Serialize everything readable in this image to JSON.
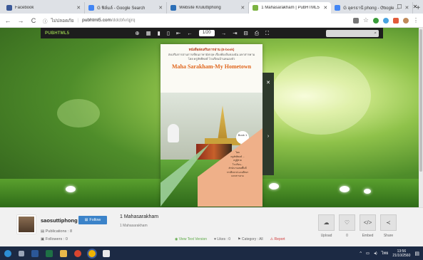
{
  "browser": {
    "tabs": [
      {
        "title": "Facebook",
        "color": "#3b5998",
        "active": false
      },
      {
        "title": "G  ฟิล์มล์ - Google Search",
        "color": "#4285f4",
        "active": false
      },
      {
        "title": "Website Kruluttiphong",
        "color": "#2c6fb7",
        "active": false
      },
      {
        "title": "1 Mahasarakham | PubHTML5",
        "color": "#7cb342",
        "active": true
      },
      {
        "title": "G  อุดรธานี phong - Google Search",
        "color": "#4285f4",
        "active": false
      }
    ],
    "new_tab": "+",
    "window_controls": {
      "minimize": "–",
      "maximize": "☐",
      "close": "✕"
    },
    "nav": {
      "back": "←",
      "forward": "→",
      "reload": "C"
    },
    "security_label": "ไม่ปลอดภัย",
    "url_host": "pubhtml5.com",
    "url_path": "/ddcbfv/qjrq"
  },
  "viewer": {
    "logo": "PUBHTML5",
    "page_field": "1/20",
    "tools": [
      "⊕",
      "▦",
      "▮",
      "▯",
      "⇤",
      "←",
      "→",
      "⇥",
      "⊟",
      "⎙",
      "⛶"
    ],
    "search_icon": "⌕"
  },
  "book_cover": {
    "line1": "หนังสือส่งเสริมการอ่าน (E-book)",
    "line2": "ส่งเสริมการอ่านการเขียนภาษาอังกฤษ เรื่องท้องถิ่นของฉัน มหาสารคาม",
    "line3": "โดย ครูลัทธิพงษ์ โรงเรียนบ้านหนองบัว",
    "title": "Maha Sarakham-My Hometown",
    "badge": "Book 1",
    "credits": [
      "โดย",
      "ครูลัทธิพงษ์ ...",
      "ครูผู้ช่วย",
      "โรงเรียน...",
      "สำนักงานเขตพื้นที่",
      "การศึกษาประถมศึกษา",
      "มหาสารคาม"
    ],
    "side_close": "✕",
    "side_next": "›"
  },
  "publisher": {
    "username": "saosuttiphong",
    "follow_label": "Follow",
    "publications_label": "Publications :",
    "publications_count": "8",
    "followers_label": "Followers :",
    "followers_count": "0",
    "doc_title": "1 Mahasarakham",
    "doc_subtitle": "1 Mahasarakham",
    "view_text": "View Text Version",
    "likes": "Likes : 0",
    "category": "Category : All",
    "report": "Report"
  },
  "actions": [
    {
      "label": "Upload",
      "icon": "☁"
    },
    {
      "label": "0",
      "icon": "♡"
    },
    {
      "label": "Embed",
      "icon": "</>"
    },
    {
      "label": "Share",
      "icon": "≺"
    }
  ],
  "taskbar": {
    "time": "13:56",
    "date": "21/10/2560",
    "lang": "ไทย"
  }
}
